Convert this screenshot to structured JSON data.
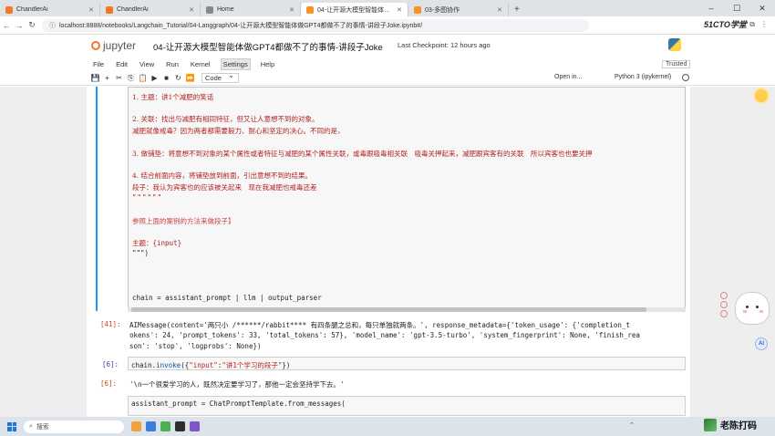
{
  "browser": {
    "tabs": [
      {
        "label": "ChandlerAi",
        "active": false
      },
      {
        "label": "ChandlerAi",
        "active": false
      },
      {
        "label": "Home",
        "active": false
      },
      {
        "label": "04-让开源大模型智能体做GPT4",
        "active": true
      },
      {
        "label": "03-多图协作",
        "active": false
      }
    ],
    "url": "localhost:8888/notebooks/Langchain_Tutorial/04-Langgraph/04-让开源大模型智能体做GPT4都做不了的事情-讲段子Joke.ipynb#/",
    "new_tab": "+",
    "brand": "51CTO学堂"
  },
  "jupyter": {
    "logo": "jupyter",
    "title": "04-让开源大模型智能体做GPT4都做不了的事情-讲段子Joke",
    "checkpoint": "Last Checkpoint: 12 hours ago",
    "menu": [
      "File",
      "Edit",
      "View",
      "Run",
      "Kernel",
      "Settings",
      "Help"
    ],
    "selected_menu": "Settings",
    "trusted": "Trusted",
    "cell_type": "Code",
    "open_in": "Open in...",
    "kernel": "Python 3 (ipykernel)"
  },
  "cell": {
    "lines": [
      "1. 主题：讲1个减肥的笑话",
      "2. 关联：找出与减肥有相同特征，但又让人意想不到的对象。",
      "减肥就像戒毒？因为两者都需要毅力、耐心和坚定的决心。不同的是，",
      "3. 做铺垫：将意想不到对象的某个属性或者特征与减肥的某个属性关联，或毒跟吸毒相关联　吸毒关押起来，减肥跟宾客有的关联　所以宾客也也要关押",
      "4. 结合前面内容，将铺垫放到前面，引出意想不到的结果。",
      "段子：我认为宾客也的应该被关起来　现在我减肥也戒毒还差",
      "参照上面的案例的方法来做段子】",
      "主题：{input}",
      "\"\"\")",
      "chain = assistant_prompt | llm | output_parser"
    ],
    "dashes": "\"\"\"\"\"\""
  },
  "output41": {
    "prompt": "[41]:",
    "line1": "AIMessage(content='两只小 /******/rabbit**** 有四条腿之总和，每只单独就两条。', response_metadata={'token_usage': {'completion_t",
    "line2": "okens': 24, 'prompt_tokens': 33, 'total_tokens': 57}, 'model_name': 'gpt-3.5-turbo', 'system_fingerprint': None, 'finish_rea",
    "line3": "son': 'stop', 'logprobs': None})"
  },
  "cell6": {
    "prompt": "[6]:",
    "code_prefix": "chain.",
    "code_fn": "invoke",
    "code_rest": "({",
    "key": "\"input\"",
    "colon": ":",
    "value": "\"讲1个学习的段子\"",
    "close": "})"
  },
  "output6": {
    "prompt": "[6]:",
    "text": "'\\n一个很爱学习的人，既然决定要学习了，那他一定会坚持学下去。'"
  },
  "cell_next": {
    "text": "assistant_prompt = ChatPromptTemplate.from_messages("
  },
  "taskbar": {
    "search_placeholder": "搜索",
    "watermark": "老陈打码"
  }
}
